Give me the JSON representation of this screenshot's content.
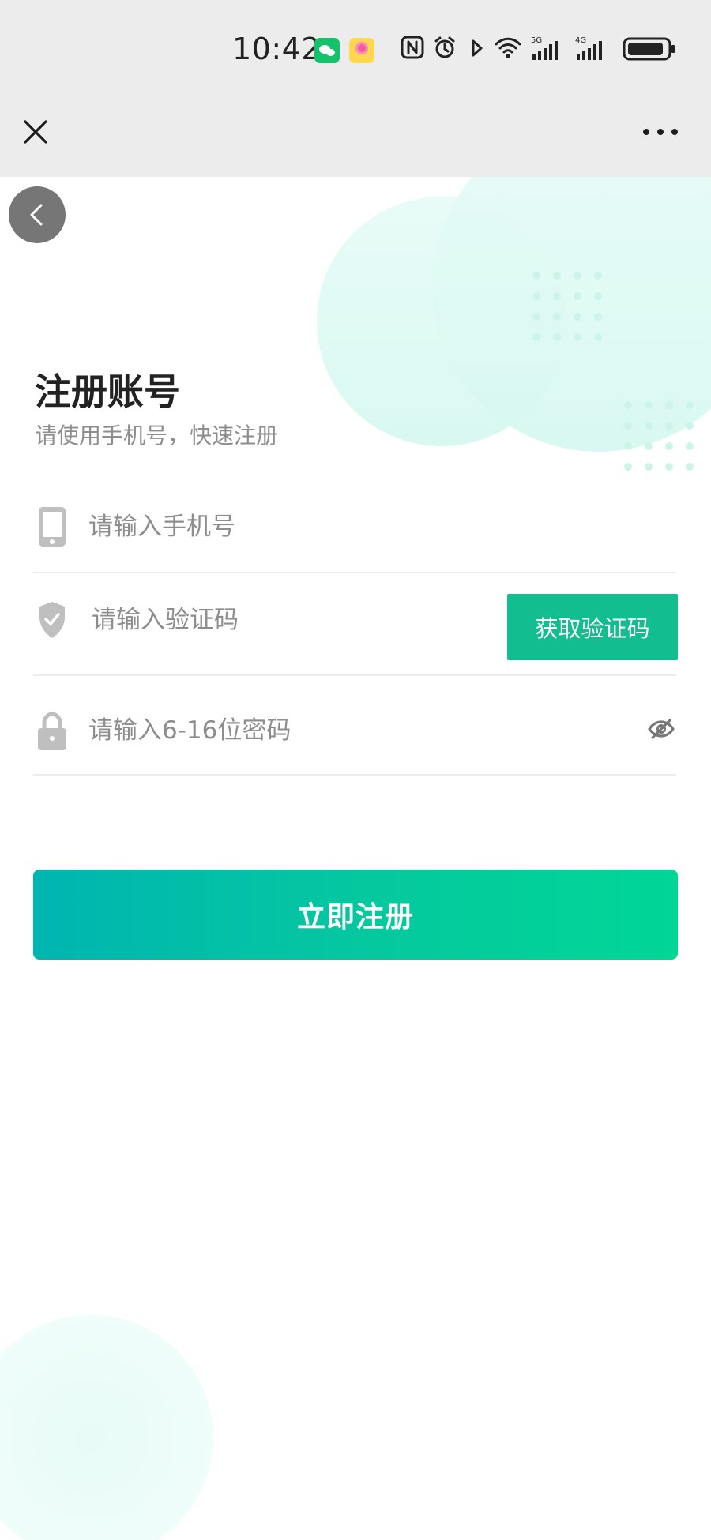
{
  "status": {
    "time": "10:42"
  },
  "header": {
    "close_icon": "close-icon",
    "more_icon": "more-icon"
  },
  "page": {
    "back_icon": "back-arrow-icon",
    "title": "注册账号",
    "subtitle": "请使用手机号，快速注册"
  },
  "form": {
    "phone": {
      "icon": "phone-icon",
      "placeholder": "请输入手机号",
      "value": ""
    },
    "code": {
      "icon": "shield-check-icon",
      "placeholder": "请输入验证码",
      "value": "",
      "button_label": "获取验证码"
    },
    "password": {
      "icon": "lock-icon",
      "placeholder": "请输入6-16位密码",
      "value": "",
      "visibility_icon": "eye-off-icon"
    },
    "submit_label": "立即注册"
  },
  "colors": {
    "accent": "#12be8f",
    "submit_start": "#00b5b1",
    "submit_end": "#00d696",
    "topbar_bg": "#ececec",
    "back_button_bg": "#767676"
  }
}
